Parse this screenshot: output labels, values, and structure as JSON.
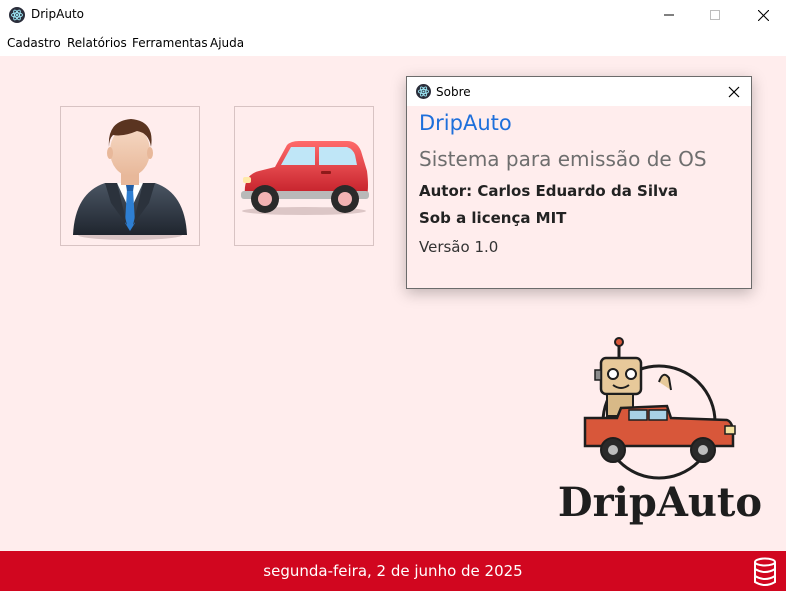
{
  "window": {
    "title": "DripAuto"
  },
  "menu": {
    "items": [
      "Cadastro",
      "Relatórios",
      "Ferramentas",
      "Ajuda"
    ]
  },
  "dialog": {
    "title": "Sobre",
    "app_name": "DripAuto",
    "subtitle": "Sistema para emissão de OS",
    "author": "Autor: Carlos Eduardo da Silva",
    "license": "Sob a licença MIT",
    "version": "Versão 1.0"
  },
  "logo": {
    "text": "DripAuto"
  },
  "status": {
    "date": "segunda-feira, 2 de junho de 2025"
  },
  "colors": {
    "accent": "#1e6fdb",
    "statusbar": "#d1061f",
    "background": "#ffeded"
  },
  "icons": {
    "app": "electron-icon",
    "tile_user": "businessman-icon",
    "tile_car": "red-car-icon",
    "status": "database-icon"
  }
}
